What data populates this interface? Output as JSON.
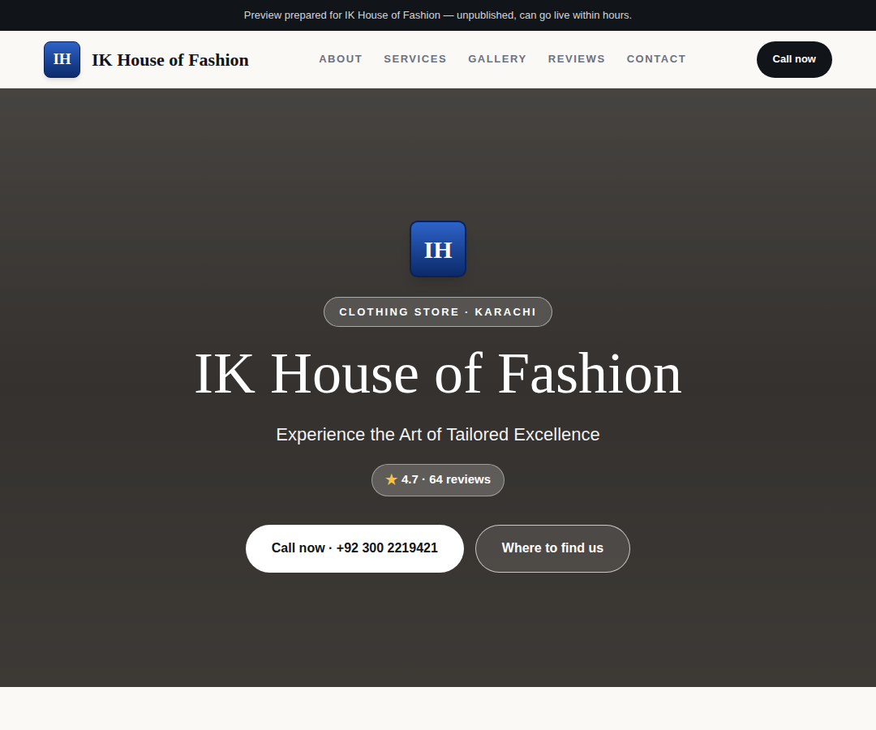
{
  "banner": "Preview prepared for IK House of Fashion — unpublished, can go live within hours.",
  "brand": {
    "logo": "IH",
    "name": "IK House of Fashion"
  },
  "nav": [
    {
      "label": "ABOUT"
    },
    {
      "label": "SERVICES"
    },
    {
      "label": "GALLERY"
    },
    {
      "label": "REVIEWS"
    },
    {
      "label": "CONTACT"
    }
  ],
  "header_cta": "Call now",
  "hero": {
    "logo": "IH",
    "badge": "CLOTHING STORE · KARACHI",
    "title": "IK House of Fashion",
    "subtitle": "Experience the Art of Tailored Excellence",
    "rating": {
      "icon": "★",
      "text": "4.7 · 64 reviews"
    },
    "buttons": [
      {
        "label": "Call now · +92 300 2219421",
        "kind": "primary"
      },
      {
        "label": "Where to find us",
        "kind": "outline"
      }
    ]
  }
}
